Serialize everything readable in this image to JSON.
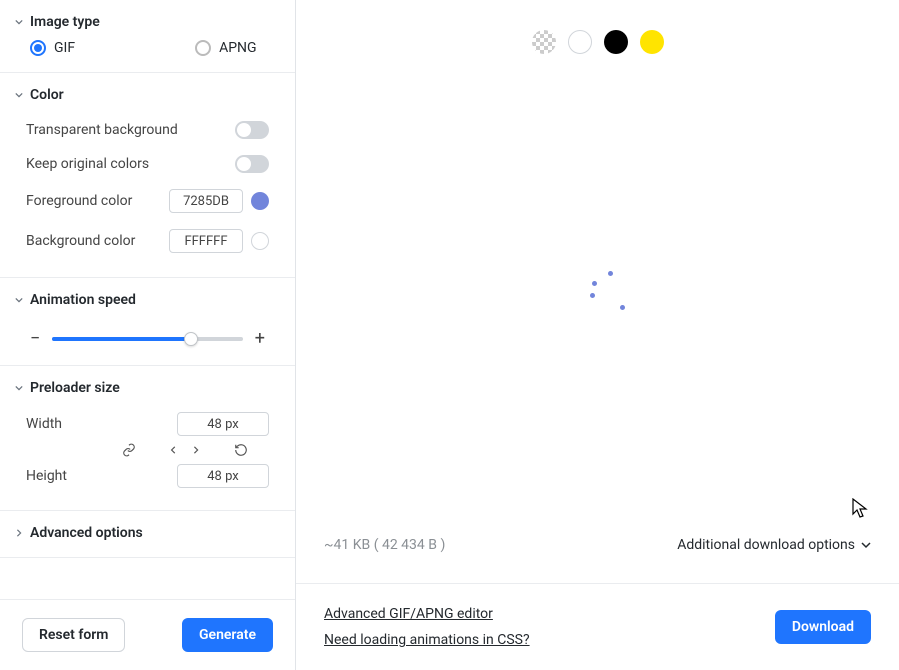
{
  "sections": {
    "image_type": {
      "title": "Image type",
      "options": [
        "GIF",
        "APNG"
      ],
      "selected": "GIF"
    },
    "color": {
      "title": "Color",
      "transparent_bg_label": "Transparent background",
      "keep_colors_label": "Keep original colors",
      "fg_label": "Foreground color",
      "fg_value": "7285DB",
      "fg_swatch": "#7285DB",
      "bg_label": "Background color",
      "bg_value": "FFFFFF",
      "bg_swatch": "#FFFFFF"
    },
    "speed": {
      "title": "Animation speed",
      "percent": 73
    },
    "size": {
      "title": "Preloader size",
      "width_label": "Width",
      "width_value": "48 px",
      "height_label": "Height",
      "height_value": "48 px"
    },
    "advanced": {
      "title": "Advanced options"
    }
  },
  "footer": {
    "reset_label": "Reset form",
    "generate_label": "Generate"
  },
  "preview": {
    "swatches": [
      "transparent",
      "white",
      "black",
      "yellow"
    ],
    "filesize": "~41 KB ( 42 434 B )",
    "additional_label": "Additional download options"
  },
  "bottom": {
    "link1": "Advanced GIF/APNG editor",
    "link2": "Need loading animations in CSS?",
    "download_label": "Download"
  }
}
